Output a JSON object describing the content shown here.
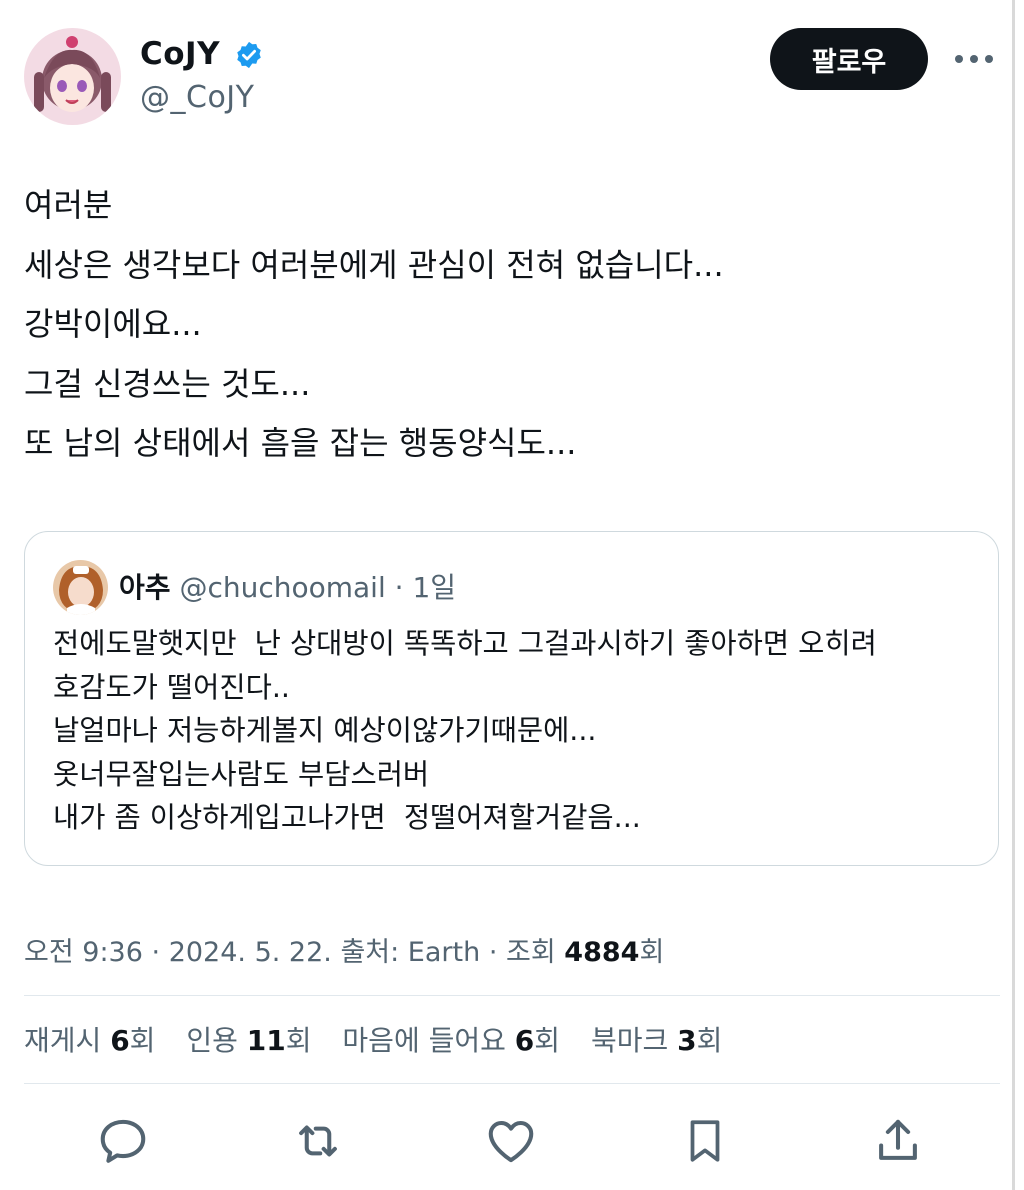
{
  "author": {
    "display_name": "CoJY",
    "handle": "@_CoJY",
    "verified_icon": "verified-badge-icon",
    "follow_label": "팔로우"
  },
  "tweet": {
    "lines": [
      "여러분",
      "세상은 생각보다 여러분에게 관심이 전혀 없습니다...",
      "강박이에요...",
      "그걸 신경쓰는 것도...",
      "또 남의 상태에서 흠을 잡는 행동양식도..."
    ]
  },
  "quote": {
    "name": "아추",
    "handle": "@chuchoomail",
    "separator": "·",
    "time": "1일",
    "lines": [
      "전에도말햇지만  난 상대방이 똑똑하고 그걸과시하기 좋아하면 오히려",
      "호감도가 떨어진다..",
      "날얼마나 저능하게볼지 예상이않가기때문에...",
      "옷너무잘입는사람도 부담스러버",
      "내가 좀 이상하게입고나가면  정떨어져할거같음..."
    ]
  },
  "meta": {
    "time": "오전 9:36",
    "sep1": "·",
    "date": "2024. 5. 22.",
    "source": "출처: Earth",
    "sep2": "·",
    "views_label": "조회",
    "views_count": "4884",
    "views_unit": "회"
  },
  "stats": {
    "reposts_label": "재게시",
    "reposts_count": "6",
    "quotes_label": "인용",
    "quotes_count": "11",
    "likes_label": "마음에 들어요",
    "likes_count": "6",
    "bookmarks_label": "북마크",
    "bookmarks_count": "3",
    "unit": "회"
  },
  "actions": [
    "reply-icon",
    "repost-icon",
    "like-icon",
    "bookmark-icon",
    "share-icon"
  ],
  "colors": {
    "text": "#0f1419",
    "secondary": "#536471",
    "verified": "#1d9bf0",
    "border": "#cfd9de"
  }
}
